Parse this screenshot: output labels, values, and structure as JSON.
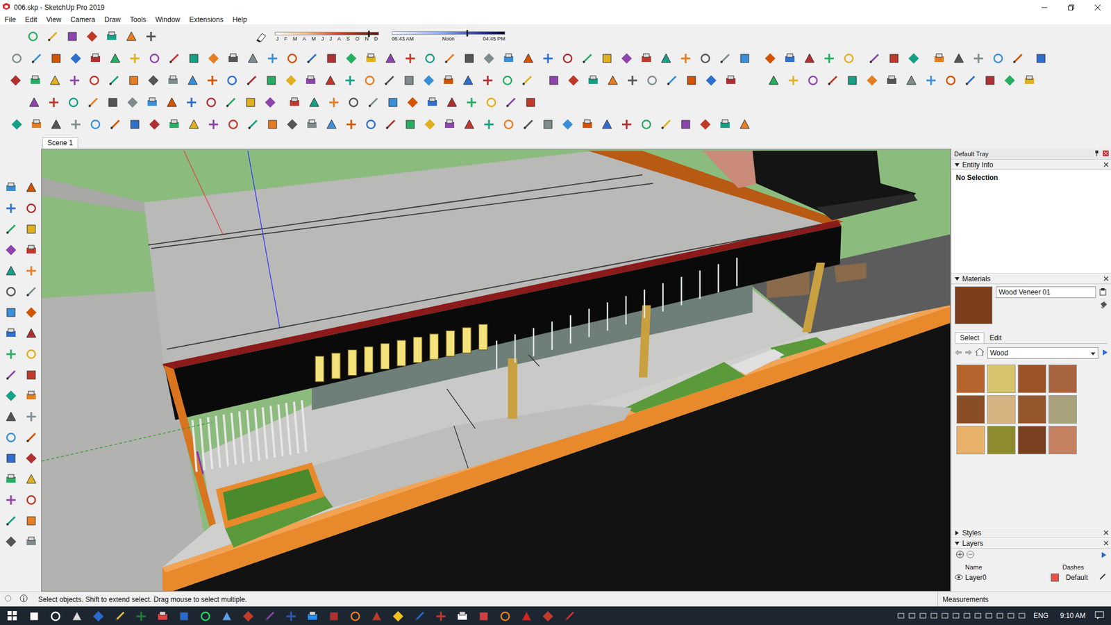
{
  "window": {
    "title": "006.skp - SketchUp Pro 2019"
  },
  "menu": [
    "File",
    "Edit",
    "View",
    "Camera",
    "Draw",
    "Tools",
    "Window",
    "Extensions",
    "Help"
  ],
  "shadow_toolbar": {
    "months": [
      "J",
      "F",
      "M",
      "A",
      "M",
      "J",
      "J",
      "A",
      "S",
      "O",
      "N",
      "D"
    ],
    "date_level": 0.9,
    "time_start": "06:43 AM",
    "time_mid": "Noon",
    "time_end": "04:45 PM",
    "time_level": 0.66
  },
  "scene_tabs": [
    {
      "label": "Scene 1",
      "selected": true
    }
  ],
  "tray": {
    "title": "Default Tray",
    "entity_info": {
      "title": "Entity Info",
      "expanded": true,
      "text": "No Selection"
    },
    "materials": {
      "title": "Materials",
      "expanded": true,
      "current_name": "Wood Veneer 01",
      "current_color": "#7b3d1b",
      "tabs": [
        {
          "label": "Select",
          "selected": true
        },
        {
          "label": "Edit",
          "selected": false
        }
      ],
      "library": "Wood",
      "swatches": [
        {
          "color": "#b5642e"
        },
        {
          "color": "#d8c46c"
        },
        {
          "color": "#9c5328"
        },
        {
          "color": "#a8643e"
        },
        {
          "color": "#8a4e26"
        },
        {
          "color": "#d6b482"
        },
        {
          "color": "#96562c"
        },
        {
          "color": "#aaa27c"
        },
        {
          "color": "#e8b26a"
        },
        {
          "color": "#8e8a2e"
        },
        {
          "color": "#7a4020"
        },
        {
          "color": "#c48060"
        }
      ]
    },
    "styles": {
      "title": "Styles",
      "expanded": false
    },
    "layers": {
      "title": "Layers",
      "expanded": true,
      "columns": [
        "Name",
        "Dashes"
      ],
      "rows": [
        {
          "name": "Layer0",
          "visible": true,
          "color": "#e8504a",
          "dashes": "Default"
        }
      ]
    }
  },
  "status_bar": {
    "hint": "Select objects. Shift to extend select. Drag mouse to select multiple.",
    "measurements_label": "Measurements"
  },
  "taskbar": {
    "language": "ENG",
    "time": "9:10 AM"
  }
}
